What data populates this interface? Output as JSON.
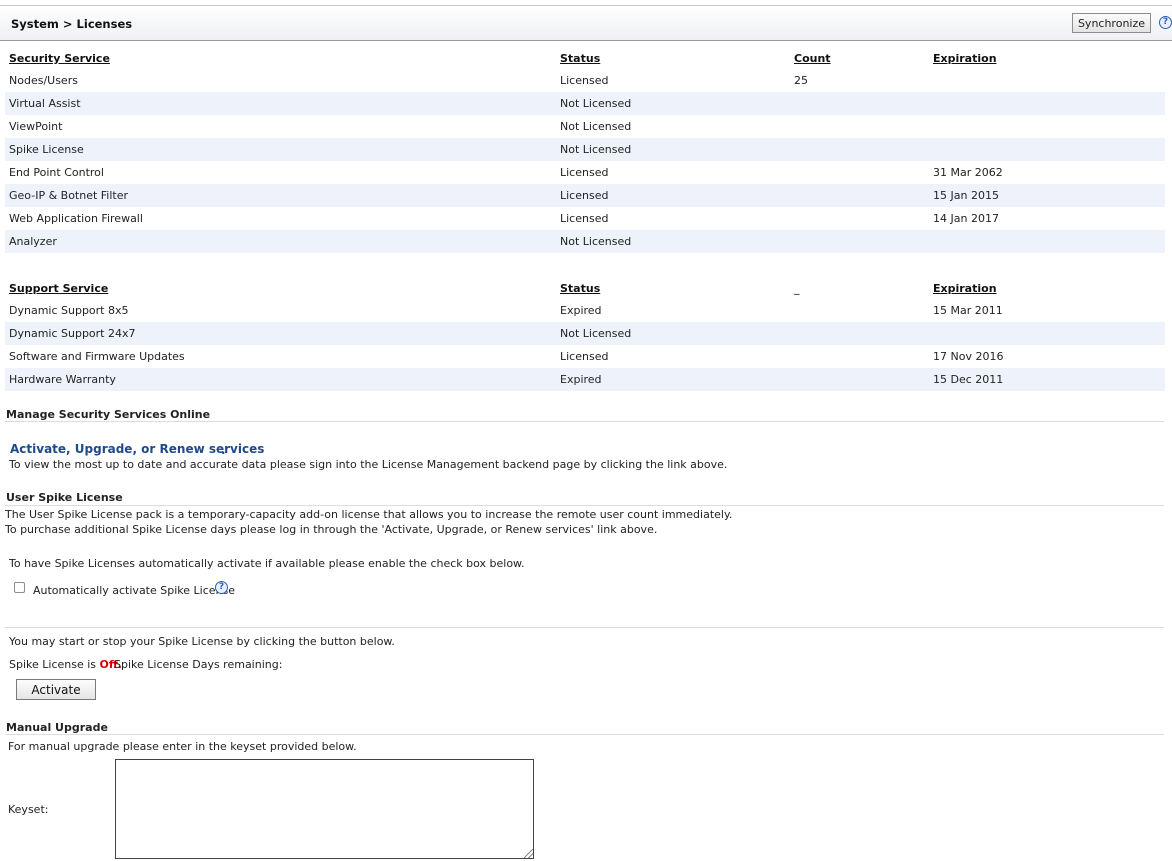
{
  "header": {
    "breadcrumb": "System > Licenses",
    "synchronize_label": "Synchronize",
    "help_glyph": "?"
  },
  "security_table": {
    "headers": [
      "Security Service",
      "Status",
      "Count",
      "Expiration"
    ],
    "rows": [
      [
        "Nodes/Users",
        "Licensed",
        "25",
        ""
      ],
      [
        "Virtual Assist",
        "Not Licensed",
        "",
        ""
      ],
      [
        "ViewPoint",
        "Not Licensed",
        "",
        ""
      ],
      [
        "Spike License",
        "Not Licensed",
        "",
        ""
      ],
      [
        "End Point Control",
        "Licensed",
        "",
        "31 Mar 2062"
      ],
      [
        "Geo-IP & Botnet Filter",
        "Licensed",
        "",
        "15 Jan 2015"
      ],
      [
        "Web Application Firewall",
        "Licensed",
        "",
        "14 Jan 2017"
      ],
      [
        "Analyzer",
        "Not Licensed",
        "",
        ""
      ]
    ]
  },
  "support_table": {
    "headers": [
      "Support Service",
      "Status",
      "_",
      "Expiration"
    ],
    "rows": [
      [
        "Dynamic Support 8x5",
        "Expired",
        "",
        "15 Mar 2011"
      ],
      [
        "Dynamic Support 24x7",
        "Not Licensed",
        "",
        ""
      ],
      [
        "Software and Firmware Updates",
        "Licensed",
        "",
        "17 Nov 2016"
      ],
      [
        "Hardware Warranty",
        "Expired",
        "",
        "15 Dec 2011"
      ]
    ]
  },
  "manage": {
    "title": "Manage Security Services Online",
    "link_label": "Activate, Upgrade, or Renew services",
    "link_suffix": ".",
    "description": "To view the most up to date and accurate data please sign into the License Management backend page by clicking the link above."
  },
  "spike": {
    "title": "User Spike License",
    "line1": "The User Spike License pack is a temporary-capacity add-on license that allows you to increase the remote user count immediately.",
    "line2": "To purchase additional Spike License days please log in through the 'Activate, Upgrade, or Renew services' link above.",
    "auto_instruction": "To have Spike Licenses automatically activate if available please enable the check box below.",
    "auto_checkbox_label": "Automatically activate Spike License",
    "auto_checked": false,
    "start_stop_text": "You may start or stop your Spike License by clicking the button below.",
    "status_prefix": "Spike License is ",
    "status_value": "Off.",
    "days_remaining_label": "Spike License Days remaining:",
    "activate_label": "Activate"
  },
  "manual_upgrade": {
    "title": "Manual Upgrade",
    "description": "For manual upgrade please enter in the keyset provided below.",
    "keyset_label": "Keyset:",
    "keyset_value": ""
  }
}
